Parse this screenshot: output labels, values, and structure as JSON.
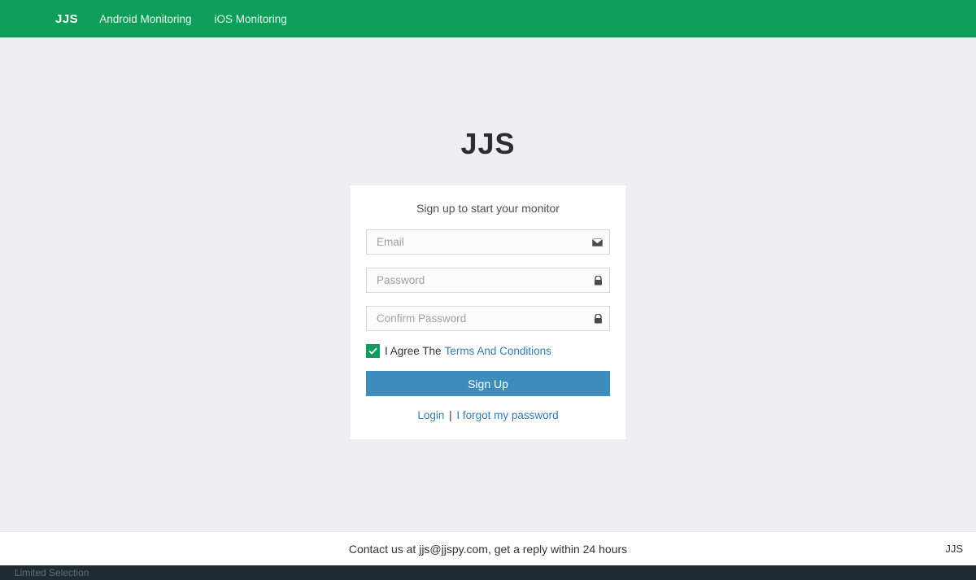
{
  "nav": {
    "brand": "JJS",
    "links": [
      "Android Monitoring",
      "iOS Monitoring"
    ]
  },
  "logo": "JJS",
  "form": {
    "heading": "Sign up to start your monitor",
    "email_placeholder": "Email",
    "password_placeholder": "Password",
    "confirm_placeholder": "Confirm Password",
    "agree_text": "I Agree The",
    "terms_link": "Terms And Conditions",
    "signup_btn": "Sign Up",
    "login_link": "Login",
    "forgot_link": "I forgot my password",
    "separator": " | "
  },
  "footer": {
    "contact": "Contact us at jjs@jjspy.com, get a reply within 24 hours",
    "brand": "JJS",
    "dark_text": "Limited Selection"
  }
}
